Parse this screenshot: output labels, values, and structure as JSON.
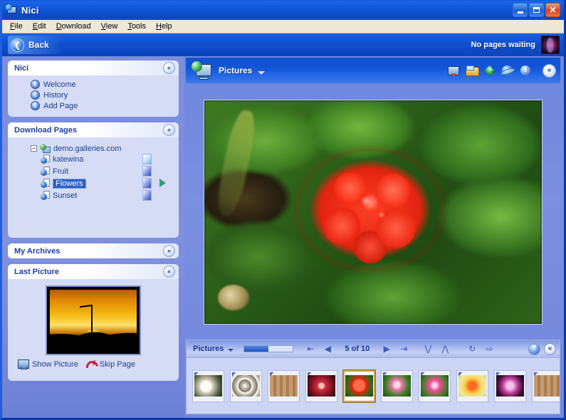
{
  "window": {
    "title": "Nici",
    "title_icon": "app-monitor-globe-icon",
    "minimize_label": "Minimize",
    "maximize_label": "Maximize",
    "close_label": "Close"
  },
  "menubar": {
    "items": [
      {
        "label": "File",
        "mnemonic": "F"
      },
      {
        "label": "Edit",
        "mnemonic": "E"
      },
      {
        "label": "Download",
        "mnemonic": "D"
      },
      {
        "label": "View",
        "mnemonic": "V"
      },
      {
        "label": "Tools",
        "mnemonic": "T"
      },
      {
        "label": "Help",
        "mnemonic": "H"
      }
    ]
  },
  "backbar": {
    "back_label": "Back",
    "back_icon": "back-arrow-icon",
    "status_text": "No pages waiting",
    "logo_icon": "app-logo-icon"
  },
  "sidebar": {
    "panels": [
      {
        "title": "Nici",
        "toggle_glyph": "«",
        "toggle_state": "expanded",
        "links": [
          {
            "label": "Welcome",
            "icon": "info-icon"
          },
          {
            "label": "History",
            "icon": "info-icon"
          },
          {
            "label": "Add Page",
            "icon": "info-icon"
          }
        ]
      },
      {
        "title": "Download Pages",
        "toggle_glyph": "«",
        "toggle_state": "expanded",
        "root": {
          "label": "demo.galleries.com",
          "expander": "−",
          "icon": "website-picture-icon"
        },
        "children": [
          {
            "label": "katewina",
            "selected": false,
            "bar": "light",
            "playing": false
          },
          {
            "label": "Fruit",
            "selected": false,
            "bar": "dark",
            "playing": false
          },
          {
            "label": "Flowers",
            "selected": true,
            "bar": "dark",
            "playing": true
          },
          {
            "label": "Sunset",
            "selected": false,
            "bar": "dark",
            "playing": false
          }
        ]
      },
      {
        "title": "My Archives",
        "toggle_glyph": "»",
        "toggle_state": "collapsed"
      },
      {
        "title": "Last Picture",
        "toggle_glyph": "«",
        "toggle_state": "expanded",
        "thumbnail_alt": "sunset-photo-thumbnail",
        "actions": [
          {
            "label": "Show Picture",
            "icon": "monitor-icon"
          },
          {
            "label": "Skip Page",
            "icon": "skip-arrow-icon"
          }
        ]
      }
    ]
  },
  "main": {
    "header": {
      "title": "Pictures",
      "icon": "pictures-monitor-globe-icon",
      "dropdown_icon": "chevron-down-icon",
      "tool_icons": [
        {
          "name": "download-icon"
        },
        {
          "name": "folder-open-icon"
        },
        {
          "name": "plugin-icon"
        },
        {
          "name": "internet-explorer-icon"
        },
        {
          "name": "info-icon"
        }
      ],
      "toggle_glyph": "«",
      "toggle_state": "expanded"
    },
    "photo": {
      "alt": "red-rose-photograph",
      "description": "Red rose flower in green foliage"
    },
    "filmstrip": {
      "title": "Pictures",
      "dropdown_icon": "chevron-down-icon",
      "progress_percent": 50,
      "counter": "5 of 10",
      "current_index": 5,
      "total": 10,
      "nav_buttons": [
        {
          "name": "first-picture-button",
          "glyph": "⇤"
        },
        {
          "name": "previous-picture-button",
          "glyph": "◀"
        },
        {
          "name": "next-picture-button",
          "glyph": "▶"
        },
        {
          "name": "last-picture-button",
          "glyph": "⇥"
        },
        {
          "name": "move-down-button",
          "glyph": "⋁"
        },
        {
          "name": "move-up-button",
          "glyph": "⋀"
        },
        {
          "name": "refresh-button",
          "glyph": "↻"
        },
        {
          "name": "skip-forward-button",
          "glyph": "⇨"
        }
      ],
      "help_glyph": "?",
      "toggle_glyph": "«",
      "thumbnails": [
        {
          "name": "white-rose-thumbnail",
          "selected": false
        },
        {
          "name": "grey-spiral-rose-thumbnail",
          "selected": false
        },
        {
          "name": "rose-on-fence-thumbnail",
          "selected": false
        },
        {
          "name": "dark-red-rose-thumbnail",
          "selected": false
        },
        {
          "name": "red-rose-thumbnail",
          "selected": true
        },
        {
          "name": "small-pink-rose-thumbnail",
          "selected": false
        },
        {
          "name": "pink-rose-thumbnail",
          "selected": false
        },
        {
          "name": "orange-tulip-thumbnail",
          "selected": false
        },
        {
          "name": "purple-lily-thumbnail",
          "selected": false
        },
        {
          "name": "pink-rose-fence-thumbnail",
          "selected": false
        }
      ]
    }
  },
  "colors": {
    "titlebar_blue": "#0f52cf",
    "sidebar_blue": "#7b8ddd",
    "panel_body": "#d6dcf5",
    "panel_title_text": "#1f3f9e",
    "selection_blue": "#2b5fc4",
    "menubar_tan": "#ece9d8",
    "close_red": "#d6421d",
    "selected_thumb_border": "#c9a24d"
  }
}
